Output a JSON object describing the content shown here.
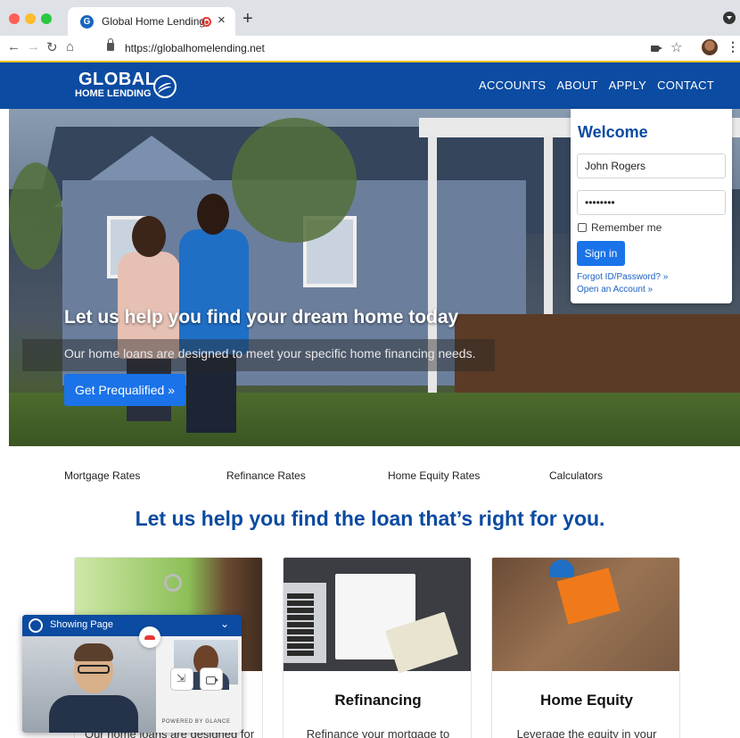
{
  "browser": {
    "tab_title": "Global Home Lending",
    "favicon_letter": "G",
    "url": "https://globalhomelending.net",
    "icons": [
      "back-icon",
      "forward-icon",
      "reload-icon",
      "home-icon",
      "lock-icon",
      "camera-icon",
      "star-icon",
      "profile-avatar",
      "more-icon"
    ]
  },
  "header": {
    "logo_line1": "GLOBAL",
    "logo_line2": "HOME LENDING",
    "nav": [
      "ACCOUNTS",
      "ABOUT",
      "APPLY",
      "CONTACT"
    ]
  },
  "hero": {
    "title": "Let us help you find your dream home today",
    "subtitle": "Our home loans are designed to meet your specific home financing needs.",
    "cta_label": "Get Prequalified »"
  },
  "login": {
    "title": "Welcome",
    "username_value": "John Rogers",
    "password_value": "••••••••",
    "remember_label": "Remember me",
    "signin_label": "Sign in",
    "forgot_link": "Forgot ID/Password? »",
    "open_account_link": "Open an Account »"
  },
  "quick_links": [
    "Mortgage Rates",
    "Refinance Rates",
    "Home Equity Rates",
    "Calculators"
  ],
  "section_title": "Let us help you find the loan that’s right for you.",
  "cards": [
    {
      "heading": "",
      "text": "Our home loans are designed for"
    },
    {
      "heading": "Refinancing",
      "text": "Refinance your mortgage to"
    },
    {
      "heading": "Home Equity",
      "text": "Leverage the equity in your"
    }
  ],
  "glance": {
    "title": "Showing Page",
    "powered_by": "POWERED BY GLANCE"
  },
  "colors": {
    "brand_blue": "#0b4ba1",
    "button_blue": "#1a73e8",
    "accent_line": "#f0c419"
  }
}
